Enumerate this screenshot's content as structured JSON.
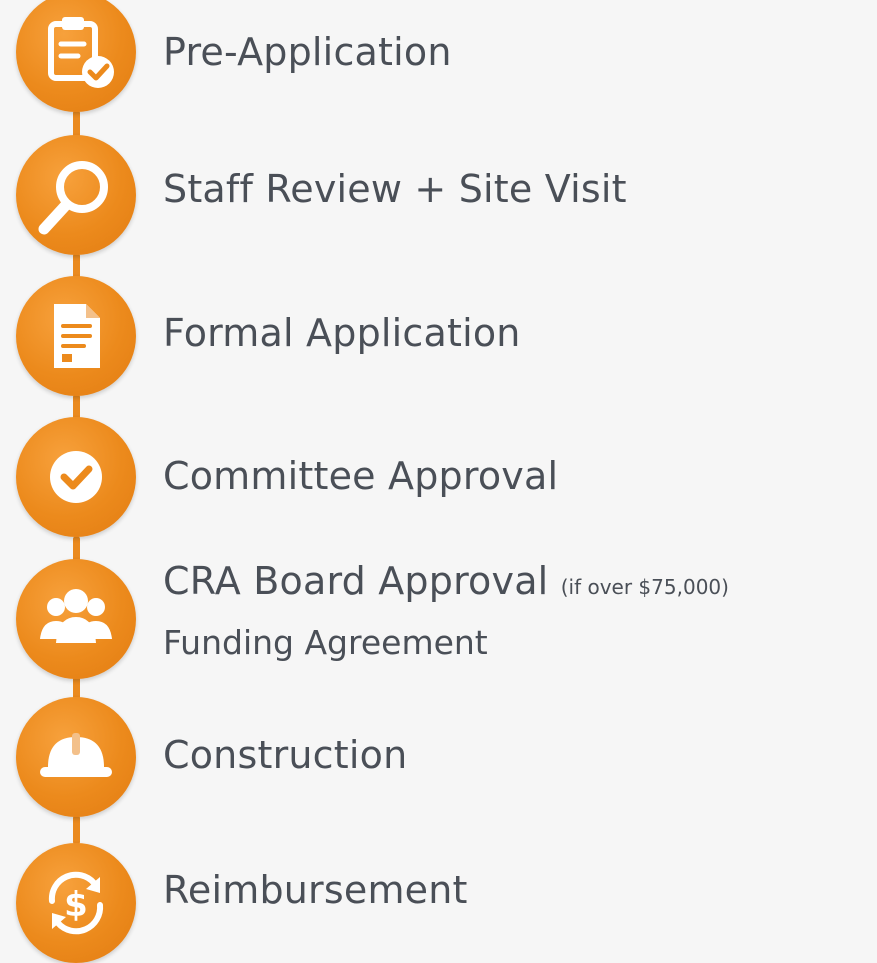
{
  "colors": {
    "accent": "#ec8a1c",
    "text": "#4a4f57",
    "background": "#f6f6f6"
  },
  "steps": [
    {
      "label": "Pre-Application",
      "icon": "clipboard-check-icon"
    },
    {
      "label": "Staff Review + Site Visit",
      "icon": "magnifier-icon"
    },
    {
      "label": "Formal Application",
      "icon": "document-icon"
    },
    {
      "label": "Committee Approval",
      "icon": "check-circle-icon"
    },
    {
      "label": "CRA Board Approval",
      "note": "(if over $75,000)",
      "sublabel": "Funding Agreement",
      "icon": "group-icon"
    },
    {
      "label": "Construction",
      "icon": "hard-hat-icon"
    },
    {
      "label": "Reimbursement",
      "icon": "dollar-cycle-icon"
    }
  ]
}
